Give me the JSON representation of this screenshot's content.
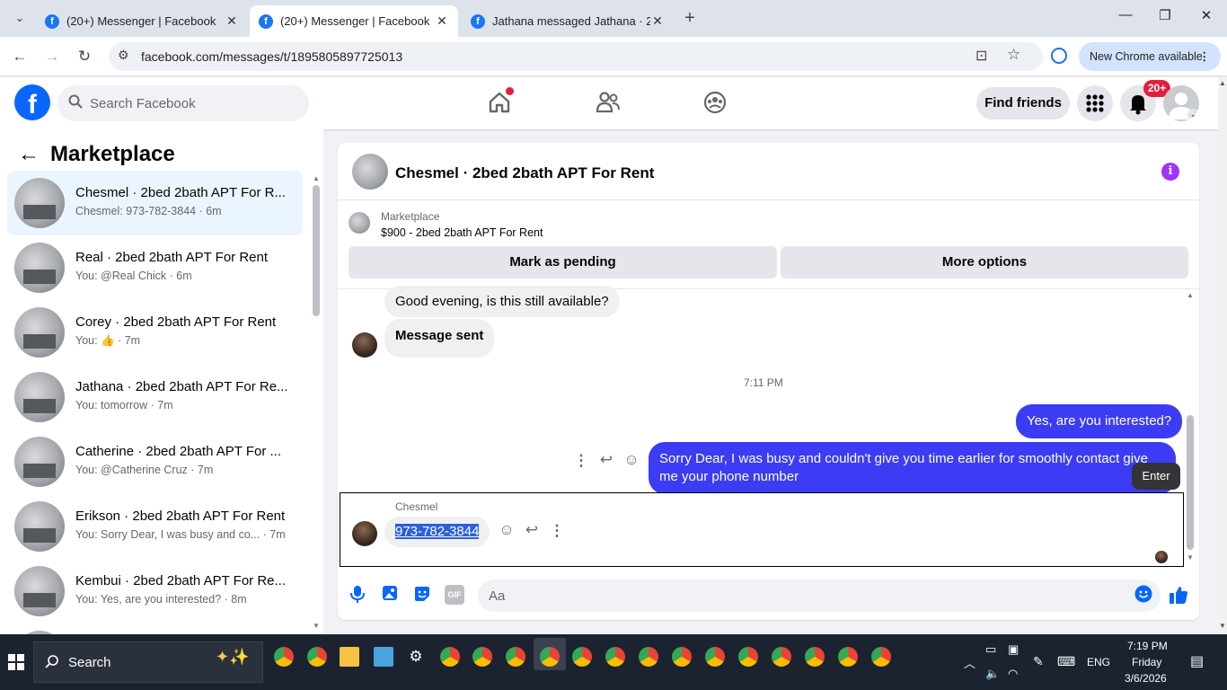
{
  "browser": {
    "tabs": [
      {
        "title": "(20+) Messenger | Facebook",
        "active": false
      },
      {
        "title": "(20+) Messenger | Facebook",
        "active": true
      },
      {
        "title": "Jathana messaged Jathana · 2be",
        "active": false
      }
    ],
    "url": "facebook.com/messages/t/1895805897725013",
    "update_label": "New Chrome available"
  },
  "fb_header": {
    "search_placeholder": "Search Facebook",
    "find_friends": "Find friends",
    "notif_badge": "20+"
  },
  "sidebar": {
    "title": "Marketplace",
    "conversations": [
      {
        "title": "Chesmel · 2bed 2bath APT For R...",
        "sub": "Chesmel: 973-782-3844 · 6m",
        "active": true
      },
      {
        "title": "Real · 2bed 2bath APT For Rent",
        "sub": "You: @Real Chick · 6m"
      },
      {
        "title": "Corey · 2bed 2bath APT For Rent",
        "sub": "You: 👍 · 7m"
      },
      {
        "title": "Jathana · 2bed 2bath APT For Re...",
        "sub": "You: tomorrow · 7m"
      },
      {
        "title": "Catherine · 2bed 2bath APT For ...",
        "sub": "You: @Catherine Cruz · 7m"
      },
      {
        "title": "Erikson · 2bed 2bath APT For Rent",
        "sub": "You: Sorry Dear, I was busy and co... · 7m"
      },
      {
        "title": "Kembui · 2bed 2bath APT For Re...",
        "sub": "You: Yes, are you interested? · 8m"
      }
    ]
  },
  "chat": {
    "title": "Chesmel · 2bed 2bath APT For Rent",
    "marketplace_label": "Marketplace",
    "listing": "$900 - 2bed 2bath APT For Rent",
    "mark_pending": "Mark as pending",
    "more_options": "More options",
    "messages": {
      "in1": "Good evening, is this still available?",
      "in2": "Message sent",
      "timestamp": "7:11 PM",
      "out1": "Yes, are you interested?",
      "out2": "Sorry Dear, I was busy and couldn't give you time earlier for smoothly contact give me your phone number",
      "sender": "Chesmel",
      "phone": "973-782-3844"
    },
    "tooltip": "Enter",
    "composer_placeholder": "Aa",
    "composer_gif": "GIF"
  },
  "taskbar": {
    "search_label": "Search",
    "lang": "ENG",
    "time": "7:19 PM",
    "day": "Friday",
    "date": "3/6/2026"
  },
  "colors": {
    "fb_blue": "#0866ff",
    "outgoing_bubble": "#3c3cf5",
    "notif_red": "#e41e3f",
    "info_purple": "#a033ff"
  }
}
